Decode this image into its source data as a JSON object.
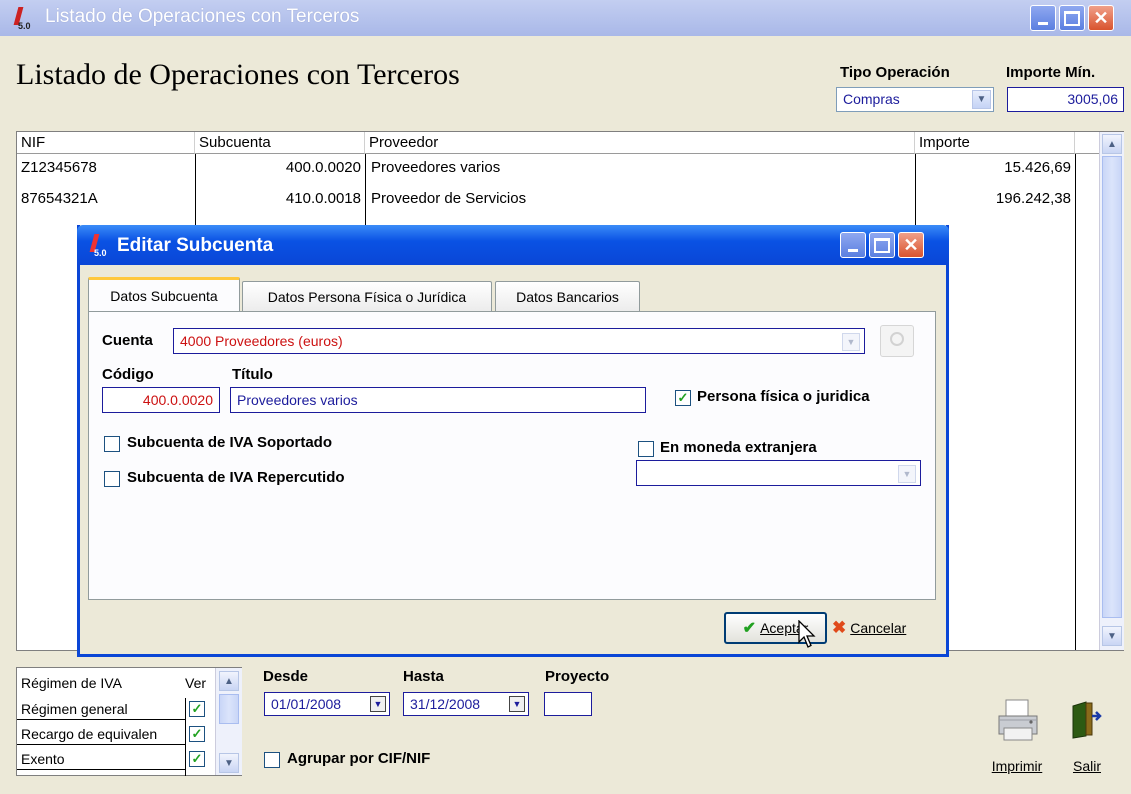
{
  "window": {
    "title": "Listado de Operaciones con Terceros",
    "heading": "Listado de Operaciones con Terceros"
  },
  "filters": {
    "tipo_operacion_label": "Tipo Operación",
    "tipo_operacion_value": "Compras",
    "importe_min_label": "Importe Mín.",
    "importe_min_value": "3005,06"
  },
  "grid": {
    "columns": [
      "NIF",
      "Subcuenta",
      "Proveedor",
      "Importe"
    ],
    "rows": [
      {
        "nif": "Z12345678",
        "subcuenta": "400.0.0020",
        "proveedor": "Proveedores varios",
        "importe": "15.426,69"
      },
      {
        "nif": "87654321A",
        "subcuenta": "410.0.0018",
        "proveedor": "Proveedor de Servicios",
        "importe": "196.242,38"
      }
    ]
  },
  "dialog": {
    "title": "Editar Subcuenta",
    "tabs": [
      "Datos Subcuenta",
      "Datos Persona Física o Jurídica",
      "Datos Bancarios"
    ],
    "cuenta_label": "Cuenta",
    "cuenta_value": "4000  Proveedores (euros)",
    "codigo_label": "Código",
    "codigo_value": "400.0.0020",
    "titulo_label": "Título",
    "titulo_value": "Proveedores varios",
    "persona_label": "Persona física o juridica",
    "iva_soportado_label": "Subcuenta de IVA Soportado",
    "iva_repercutido_label": "Subcuenta de IVA Repercutido",
    "moneda_label": "En moneda extranjera",
    "aceptar_label": "Aceptar",
    "cancelar_label": "Cancelar"
  },
  "iva": {
    "header_regimen": "Régimen de IVA",
    "header_ver": "Ver",
    "rows": [
      {
        "label": "Régimen general",
        "checked": true
      },
      {
        "label": "Recargo de equivalen",
        "checked": true
      },
      {
        "label": "Exento",
        "checked": true
      }
    ]
  },
  "dates": {
    "desde_label": "Desde",
    "desde_value": "01/01/2008",
    "hasta_label": "Hasta",
    "hasta_value": "31/12/2008",
    "proyecto_label": "Proyecto",
    "proyecto_value": ""
  },
  "agrupar_label": "Agrupar por CIF/NIF",
  "footer": {
    "imprimir_label": "Imprimir",
    "salir_label": "Salir"
  }
}
